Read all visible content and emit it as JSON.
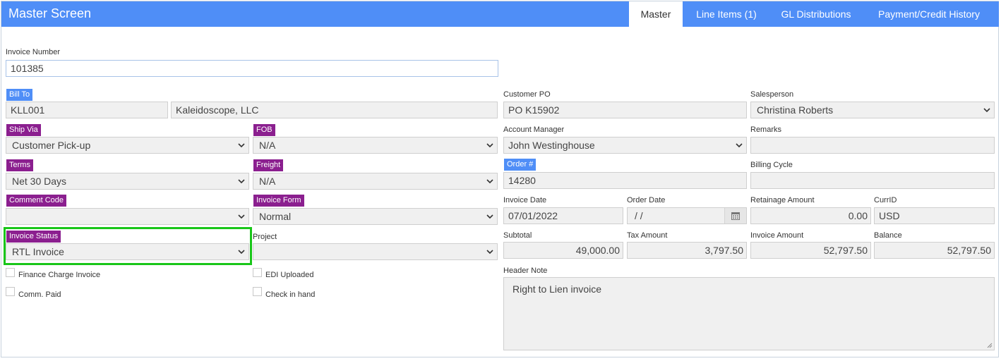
{
  "header": {
    "title": "Master Screen",
    "tabs": [
      {
        "label": "Master",
        "active": true
      },
      {
        "label": "Line Items (1)",
        "active": false
      },
      {
        "label": "GL Distributions",
        "active": false
      },
      {
        "label": "Payment/Credit History",
        "active": false
      }
    ]
  },
  "colors": {
    "accent": "#4f8ef7",
    "badge_purple": "#8b1f8f",
    "highlight": "#19c619"
  },
  "invoice_number": {
    "label": "Invoice Number",
    "value": "101385"
  },
  "bill_to": {
    "label": "Bill To",
    "code": "KLL001",
    "name": "Kaleidoscope, LLC"
  },
  "ship_via": {
    "label": "Ship Via",
    "value": "Customer Pick-up"
  },
  "fob": {
    "label": "FOB",
    "value": "N/A"
  },
  "terms": {
    "label": "Terms",
    "value": "Net 30 Days"
  },
  "freight": {
    "label": "Freight",
    "value": "N/A"
  },
  "comment_code": {
    "label": "Comment Code",
    "value": ""
  },
  "invoice_form": {
    "label": "Invoice Form",
    "value": "Normal"
  },
  "invoice_status": {
    "label": "Invoice Status",
    "value": "RTL Invoice"
  },
  "project": {
    "label": "Project",
    "value": ""
  },
  "checkboxes": {
    "finance_charge": {
      "label": "Finance Charge Invoice",
      "checked": false
    },
    "edi_uploaded": {
      "label": "EDI Uploaded",
      "checked": false
    },
    "comm_paid": {
      "label": "Comm. Paid",
      "checked": false
    },
    "check_in_hand": {
      "label": "Check in hand",
      "checked": false
    }
  },
  "customer_po": {
    "label": "Customer PO",
    "value": "PO K15902"
  },
  "salesperson": {
    "label": "Salesperson",
    "value": "Christina Roberts"
  },
  "account_manager": {
    "label": "Account Manager",
    "value": "John Westinghouse"
  },
  "remarks": {
    "label": "Remarks",
    "value": ""
  },
  "order_number": {
    "label": "Order #",
    "value": "14280"
  },
  "billing_cycle": {
    "label": "Billing Cycle",
    "value": ""
  },
  "invoice_date": {
    "label": "Invoice Date",
    "value": "07/01/2022"
  },
  "order_date": {
    "label": "Order Date",
    "value": " /  /"
  },
  "retainage_amount": {
    "label": "Retainage Amount",
    "value": "0.00"
  },
  "curr_id": {
    "label": "CurrID",
    "value": "USD"
  },
  "subtotal": {
    "label": "Subtotal",
    "value": "49,000.00"
  },
  "tax_amount": {
    "label": "Tax Amount",
    "value": "3,797.50"
  },
  "invoice_amount": {
    "label": "Invoice Amount",
    "value": "52,797.50"
  },
  "balance": {
    "label": "Balance",
    "value": "52,797.50"
  },
  "header_note": {
    "label": "Header Note",
    "value": "Right to Lien invoice"
  }
}
